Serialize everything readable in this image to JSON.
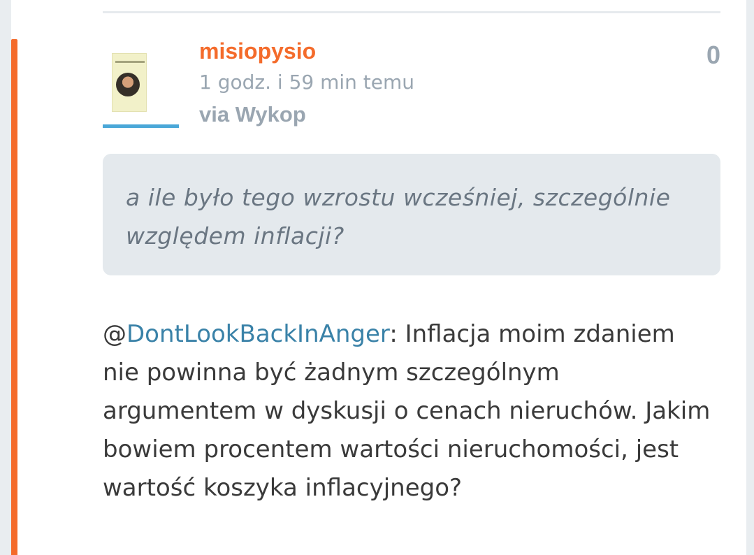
{
  "entry": {
    "author": {
      "username": "misiopysio",
      "avatar_icon": "user-avatar-icon"
    },
    "meta": {
      "time_ago": "1 godz. i 59 min temu",
      "source": "via Wykop"
    },
    "votes": "0",
    "quote": {
      "text": "a ile było tego wzrostu wcześniej, szczególnie względem inflacji?"
    },
    "body": {
      "at_sign": "@",
      "mention": "DontLookBackInAnger",
      "text": ": Inflacja moim zdaniem nie powinna być żadnym szczególnym argumentem w dyskusji o cenach nieruchów. Jakim bowiem procentem wartości nieruchomości, jest wartość koszyka inflacyjnego?"
    }
  },
  "colors": {
    "accent": "#f46b2b",
    "link": "#3a82a8",
    "meta": "#9aa6b1",
    "quote_bg": "#e4e9ed",
    "avatar_underline": "#4aa7d8"
  }
}
